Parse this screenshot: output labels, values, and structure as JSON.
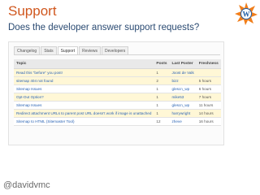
{
  "slide": {
    "title": "Support",
    "subtitle": "Does the developer answer support requests?",
    "handle": "@davidvmc"
  },
  "logo": {
    "icon": "wordpress-orange-starburst-logo"
  },
  "tabs": [
    "Changelog",
    "Stats",
    "Support",
    "Reviews",
    "Developers"
  ],
  "active_tab": "Support",
  "table": {
    "headers": {
      "topic": "Topic",
      "posts": "Posts",
      "last_poster": "Last Poster",
      "freshness": "Freshness"
    },
    "rows": [
      {
        "topic": "Read this \"before\" you post!",
        "posts": "1",
        "last_poster": "Joost de Valk",
        "freshness": ""
      },
      {
        "topic": "sitemap 404 not found",
        "posts": "2",
        "last_poster": "bizz",
        "freshness": "5 hours"
      },
      {
        "topic": "Sitemap Issues",
        "posts": "1",
        "last_poster": "glescn_wp",
        "freshness": "6 hours"
      },
      {
        "topic": "Opt-Out Option?",
        "posts": "1",
        "last_poster": "mike53",
        "freshness": "7 hours"
      },
      {
        "topic": "Sitemap Issues",
        "posts": "1",
        "last_poster": "glescn_wp",
        "freshness": "11 hours"
      },
      {
        "topic": "Redirect attachment URLs to parent post URL doesn't work if image is unattached",
        "posts": "1",
        "last_poster": "harrywright",
        "freshness": "14 hours"
      },
      {
        "topic": "Sitemap to HTML (Sitemaster Tool)",
        "posts": "12",
        "last_poster": "zheve",
        "freshness": "16 hours"
      }
    ]
  }
}
